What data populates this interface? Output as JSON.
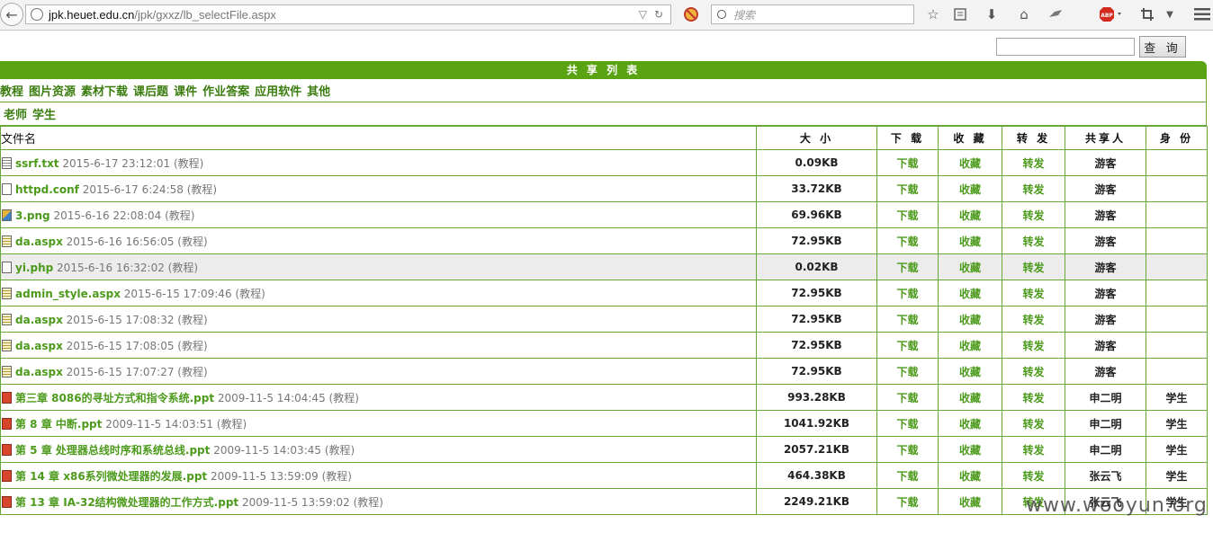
{
  "browser": {
    "url_host": "jpk.heuet.edu.cn",
    "url_path": "/jpk/gxxz/lb_selectFile.aspx",
    "search_placeholder": "搜索"
  },
  "page": {
    "query_button": "查 询",
    "header_title": "共 享 列 表",
    "categories": [
      "教程",
      "图片资源",
      "素材下载",
      "课后题",
      "课件",
      "作业答案",
      "应用软件",
      "其他"
    ],
    "roles": [
      "老师",
      "学生"
    ],
    "columns": {
      "name": "文件名",
      "size": "大 小",
      "download": "下 载",
      "collect": "收 藏",
      "forward": "转 发",
      "sharer": "共享人",
      "identity": "身 份"
    },
    "rows": [
      {
        "icon": "txt",
        "name": "ssrf.txt",
        "meta": "2015-6-17 23:12:01 (教程)",
        "size": "0.09KB",
        "dl": "下载",
        "col": "收藏",
        "fw": "转发",
        "sharer": "游客",
        "identity": ""
      },
      {
        "icon": "blank",
        "name": "httpd.conf",
        "meta": "2015-6-17 6:24:58 (教程)",
        "size": "33.72KB",
        "dl": "下载",
        "col": "收藏",
        "fw": "转发",
        "sharer": "游客",
        "identity": ""
      },
      {
        "icon": "img",
        "name": "3.png",
        "meta": "2015-6-16 22:08:04 (教程)",
        "size": "69.96KB",
        "dl": "下载",
        "col": "收藏",
        "fw": "转发",
        "sharer": "游客",
        "identity": ""
      },
      {
        "icon": "aspx",
        "name": "da.aspx",
        "meta": "2015-6-16 16:56:05 (教程)",
        "size": "72.95KB",
        "dl": "下载",
        "col": "收藏",
        "fw": "转发",
        "sharer": "游客",
        "identity": ""
      },
      {
        "icon": "blank",
        "name": "yi.php",
        "meta": "2015-6-16 16:32:02 (教程)",
        "size": "0.02KB",
        "dl": "下载",
        "col": "收藏",
        "fw": "转发",
        "sharer": "游客",
        "identity": "",
        "highlight": true
      },
      {
        "icon": "aspx",
        "name": "admin_style.aspx",
        "meta": "2015-6-15 17:09:46 (教程)",
        "size": "72.95KB",
        "dl": "下载",
        "col": "收藏",
        "fw": "转发",
        "sharer": "游客",
        "identity": ""
      },
      {
        "icon": "aspx",
        "name": "da.aspx",
        "meta": "2015-6-15 17:08:32 (教程)",
        "size": "72.95KB",
        "dl": "下载",
        "col": "收藏",
        "fw": "转发",
        "sharer": "游客",
        "identity": ""
      },
      {
        "icon": "aspx",
        "name": "da.aspx",
        "meta": "2015-6-15 17:08:05 (教程)",
        "size": "72.95KB",
        "dl": "下载",
        "col": "收藏",
        "fw": "转发",
        "sharer": "游客",
        "identity": ""
      },
      {
        "icon": "aspx",
        "name": "da.aspx",
        "meta": "2015-6-15 17:07:27 (教程)",
        "size": "72.95KB",
        "dl": "下载",
        "col": "收藏",
        "fw": "转发",
        "sharer": "游客",
        "identity": ""
      },
      {
        "icon": "ppt",
        "name": "第三章 8086的寻址方式和指令系统.ppt",
        "meta": "2009-11-5 14:04:45 (教程)",
        "size": "993.28KB",
        "dl": "下载",
        "col": "收藏",
        "fw": "转发",
        "sharer": "申二明",
        "identity": "学生"
      },
      {
        "icon": "ppt",
        "name": "第 8 章 中断.ppt",
        "meta": "2009-11-5 14:03:51 (教程)",
        "size": "1041.92KB",
        "dl": "下载",
        "col": "收藏",
        "fw": "转发",
        "sharer": "申二明",
        "identity": "学生"
      },
      {
        "icon": "ppt",
        "name": "第 5 章 处理器总线时序和系统总线.ppt",
        "meta": "2009-11-5 14:03:45 (教程)",
        "size": "2057.21KB",
        "dl": "下载",
        "col": "收藏",
        "fw": "转发",
        "sharer": "申二明",
        "identity": "学生"
      },
      {
        "icon": "ppt",
        "name": "第 14 章 x86系列微处理器的发展.ppt",
        "meta": "2009-11-5 13:59:09 (教程)",
        "size": "464.38KB",
        "dl": "下载",
        "col": "收藏",
        "fw": "转发",
        "sharer": "张云飞",
        "identity": "学生"
      },
      {
        "icon": "ppt",
        "name": "第 13 章 IA-32结构微处理器的工作方式.ppt",
        "meta": "2009-11-5 13:59:02 (教程)",
        "size": "2249.21KB",
        "dl": "下载",
        "col": "收藏",
        "fw": "转发",
        "sharer": "张云飞",
        "identity": "学生"
      }
    ]
  },
  "watermark": "www.wooyun.org",
  "colors": {
    "header_green": "#5aa313",
    "link_green": "#4c9a1b",
    "border_green": "#69a838"
  }
}
